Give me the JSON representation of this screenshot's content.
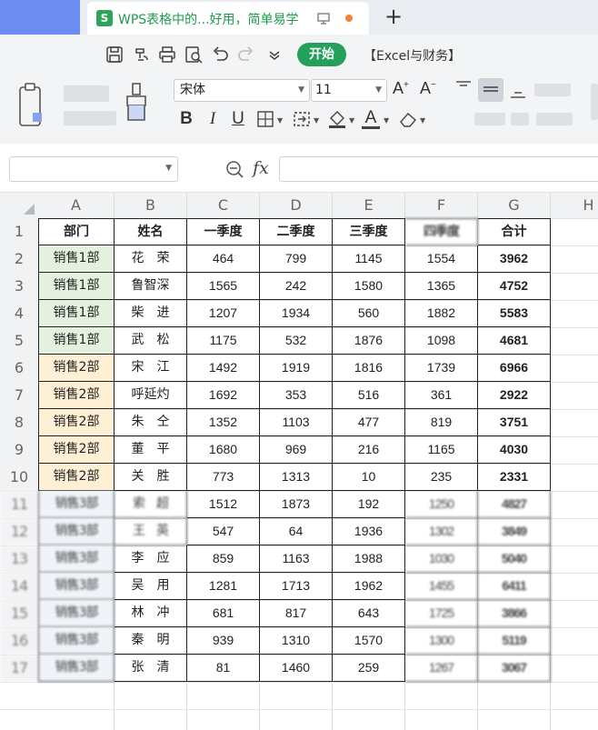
{
  "tab": {
    "logo": "S",
    "title": "WPS表格中的...好用，简单易学",
    "add": "+"
  },
  "toolbar": {
    "start_label": "开始",
    "menu_excel": "【Excel与财务】",
    "font_name": "宋体",
    "font_size": "11"
  },
  "formula_bar": {
    "fx": "fx",
    "name_value": "",
    "formula_value": ""
  },
  "columns": [
    "A",
    "B",
    "C",
    "D",
    "E",
    "F",
    "G",
    "H"
  ],
  "table": {
    "headers": [
      "部门",
      "姓名",
      "一季度",
      "二季度",
      "三季度",
      "四季度",
      "合计"
    ],
    "rows": [
      {
        "num": "1",
        "dept": "",
        "name": "",
        "q1": "",
        "q2": "",
        "q3": "",
        "q4": "",
        "total": ""
      },
      {
        "num": "2",
        "dept": "销售1部",
        "name": "花　荣",
        "q1": "464",
        "q2": "799",
        "q3": "1145",
        "q4": "1554",
        "total": "3962"
      },
      {
        "num": "3",
        "dept": "销售1部",
        "name": "鲁智深",
        "q1": "1565",
        "q2": "242",
        "q3": "1580",
        "q4": "1365",
        "total": "4752"
      },
      {
        "num": "4",
        "dept": "销售1部",
        "name": "柴　进",
        "q1": "1207",
        "q2": "1934",
        "q3": "560",
        "q4": "1882",
        "total": "5583"
      },
      {
        "num": "5",
        "dept": "销售1部",
        "name": "武　松",
        "q1": "1175",
        "q2": "532",
        "q3": "1876",
        "q4": "1098",
        "total": "4681"
      },
      {
        "num": "6",
        "dept": "销售2部",
        "name": "宋　江",
        "q1": "1492",
        "q2": "1919",
        "q3": "1816",
        "q4": "1739",
        "total": "6966"
      },
      {
        "num": "7",
        "dept": "销售2部",
        "name": "呼延灼",
        "q1": "1692",
        "q2": "353",
        "q3": "516",
        "q4": "361",
        "total": "2922"
      },
      {
        "num": "8",
        "dept": "销售2部",
        "name": "朱　仝",
        "q1": "1352",
        "q2": "1103",
        "q3": "477",
        "q4": "819",
        "total": "3751"
      },
      {
        "num": "9",
        "dept": "销售2部",
        "name": "董　平",
        "q1": "1680",
        "q2": "969",
        "q3": "216",
        "q4": "1165",
        "total": "4030"
      },
      {
        "num": "10",
        "dept": "销售2部",
        "name": "关　胜",
        "q1": "773",
        "q2": "1313",
        "q3": "10",
        "q4": "235",
        "total": "2331"
      },
      {
        "num": "11",
        "dept": "销售3部",
        "name": "索　超",
        "q1": "1512",
        "q2": "1873",
        "q3": "192",
        "q4": "1250",
        "total": "4827"
      },
      {
        "num": "12",
        "dept": "销售3部",
        "name": "王　英",
        "q1": "547",
        "q2": "64",
        "q3": "1936",
        "q4": "1302",
        "total": "3849"
      },
      {
        "num": "13",
        "dept": "销售3部",
        "name": "李　应",
        "q1": "859",
        "q2": "1163",
        "q3": "1988",
        "q4": "1030",
        "total": "5040"
      },
      {
        "num": "14",
        "dept": "销售3部",
        "name": "吴　用",
        "q1": "1281",
        "q2": "1713",
        "q3": "1962",
        "q4": "1455",
        "total": "6411"
      },
      {
        "num": "15",
        "dept": "销售3部",
        "name": "林　冲",
        "q1": "681",
        "q2": "817",
        "q3": "643",
        "q4": "1725",
        "total": "3866"
      },
      {
        "num": "16",
        "dept": "销售3部",
        "name": "秦　明",
        "q1": "939",
        "q2": "1310",
        "q3": "1570",
        "q4": "1300",
        "total": "5119"
      },
      {
        "num": "17",
        "dept": "销售3部",
        "name": "张　清",
        "q1": "81",
        "q2": "1460",
        "q3": "259",
        "q4": "1267",
        "total": "3067"
      }
    ]
  },
  "colors": {
    "accent": "#24a05a",
    "dept1_fill": "#e5f1df",
    "dept2_fill": "#fdf0d5"
  }
}
